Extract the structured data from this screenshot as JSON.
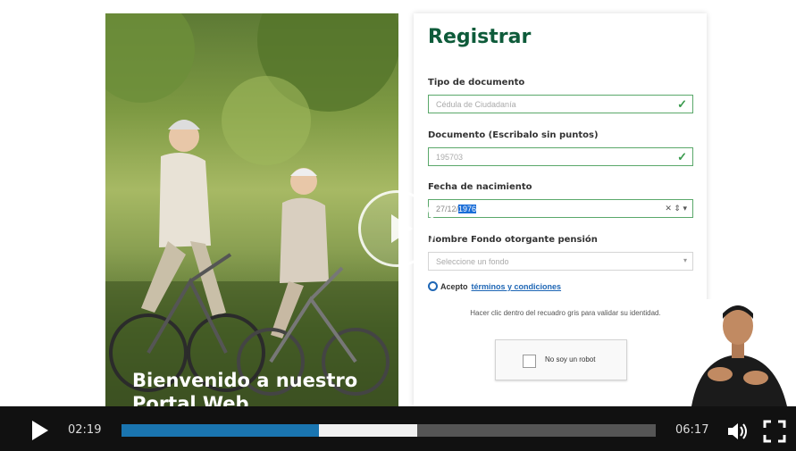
{
  "welcome": {
    "line1": "Bienvenido a nuestro",
    "line2": "Portal Web"
  },
  "form": {
    "title": "Registrar",
    "doc_type": {
      "label": "Tipo de documento",
      "value": "Cédula de Ciudadanía"
    },
    "document": {
      "label": "Documento (Escribalo sin puntos)",
      "value": "195703"
    },
    "birth_date": {
      "label": "Fecha de nacimiento",
      "value_prefix": "27/12/",
      "value_selected": "1976"
    },
    "fund": {
      "label": "Nombre Fondo otorgante pensión",
      "placeholder": "Seleccione un fondo"
    },
    "accept": {
      "label": "Acepto",
      "link": "términos y condiciones"
    },
    "hint": "Hacer clic dentro del recuadro gris para validar su identidad.",
    "captcha_label": "No soy un robot"
  },
  "player": {
    "current_time": "02:19",
    "duration": "06:17",
    "played_fraction": 0.369,
    "buffered_fraction": 0.553
  },
  "colors": {
    "brand_green": "#0e5b3a",
    "progress": "#1a75b0",
    "valid_border": "#5aa86a"
  },
  "icons": [
    "play-icon",
    "check-icon",
    "volume-icon",
    "fullscreen-icon"
  ]
}
